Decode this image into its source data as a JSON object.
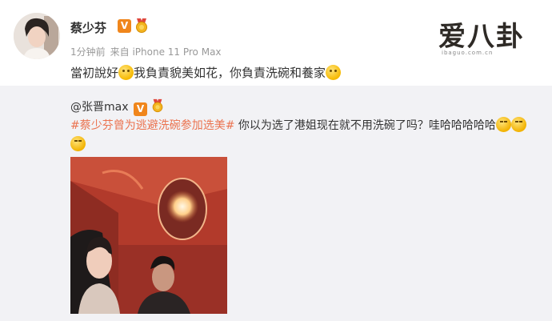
{
  "post": {
    "author": "蔡少芬",
    "verified": "V",
    "meta_time": "1分钟前",
    "meta_source": "来自 iPhone 11 Pro Max",
    "text_part1": "當初說好",
    "text_part2": "我負責貌美如花，你負責洗碗和養家"
  },
  "watermark": {
    "logo": "爱八卦",
    "site": "ibaguo.com.cn"
  },
  "repost": {
    "author_handle": "@张晋max",
    "hashtag": "#蔡少芬曾为逃避洗碗参加选美#",
    "text": " 你以为选了港姐现在就不用洗碗了吗？哇哈哈哈哈哈"
  },
  "colors": {
    "accent_link": "#eb7350",
    "verified_badge": "#f0861c",
    "repost_background": "#f2f2f5"
  },
  "icons": [
    "verified-v-icon",
    "medal-icon",
    "emoji-icon",
    "laugh-emoji-icon"
  ]
}
